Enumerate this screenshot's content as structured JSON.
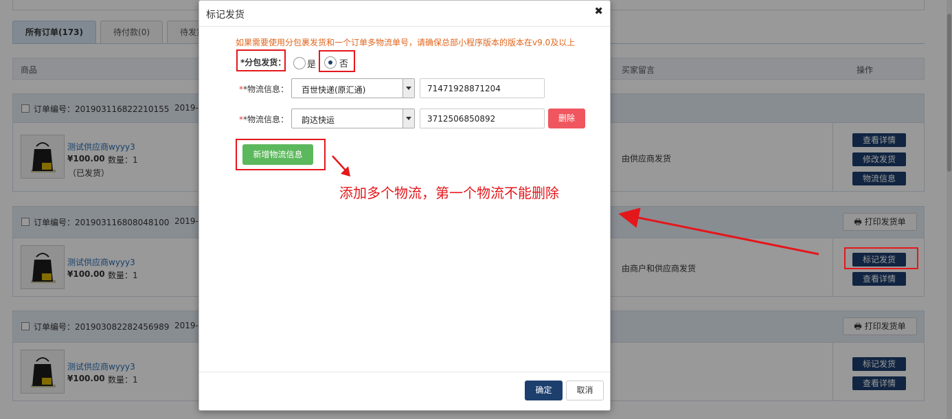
{
  "tabs": [
    {
      "label": "所有订单(173)"
    },
    {
      "label": "待付款(0)"
    },
    {
      "label": "待发货"
    }
  ],
  "table_header": {
    "goods": "商品",
    "buyer_message": "买家留言",
    "actions": "操作"
  },
  "orders": [
    {
      "order_no": "订单编号：201903116822210155",
      "date": "2019-",
      "product_name": "测试供应商wyyy3",
      "price": "¥100.00",
      "qty": "数量：1",
      "status": "（已发货）",
      "message": "由供应商发货",
      "actions": [
        "查看详情",
        "修改发货",
        "物流信息"
      ]
    },
    {
      "order_no": "订单编号：201903116808048100",
      "date": "2019-",
      "print_label": "打印发货单",
      "product_name": "测试供应商wyyy3",
      "price": "¥100.00",
      "qty": "数量：1",
      "message": "由商户和供应商发货",
      "actions": [
        "标记发货",
        "查看详情"
      ]
    },
    {
      "order_no": "订单编号：201903082282456989",
      "date": "2019-",
      "print_label": "打印发货单",
      "product_name": "测试供应商wyyy3",
      "price": "¥100.00",
      "qty": "数量：1",
      "actions": [
        "标记发货",
        "查看详情"
      ]
    }
  ],
  "dialog": {
    "title": "标记发货",
    "close": "✖",
    "notice": "如果需要使用分包裹发货和一个订单多物流单号，请确保总部小程序版本的版本在v9.0及以上",
    "split_label": "*分包发货：",
    "opt_yes": "是",
    "opt_no": "否",
    "selected": "否",
    "logistics_label": "*物流信息：",
    "logistics": [
      {
        "carrier": "百世快递(原汇通)",
        "tracking": "71471928871204"
      },
      {
        "carrier": "韵达快运",
        "tracking": "3712506850892"
      }
    ],
    "delete_label": "删除",
    "add_label": "新增物流信息",
    "annotation": "添加多个物流，第一个物流不能删除",
    "ok_label": "确定",
    "cancel_label": "取消"
  },
  "colors": {
    "accent": "#1d3f6e",
    "annotation_red": "#e4171b",
    "add_green": "#5cb85c",
    "delete_red": "#f0565f",
    "notice_orange": "#e0651c"
  }
}
